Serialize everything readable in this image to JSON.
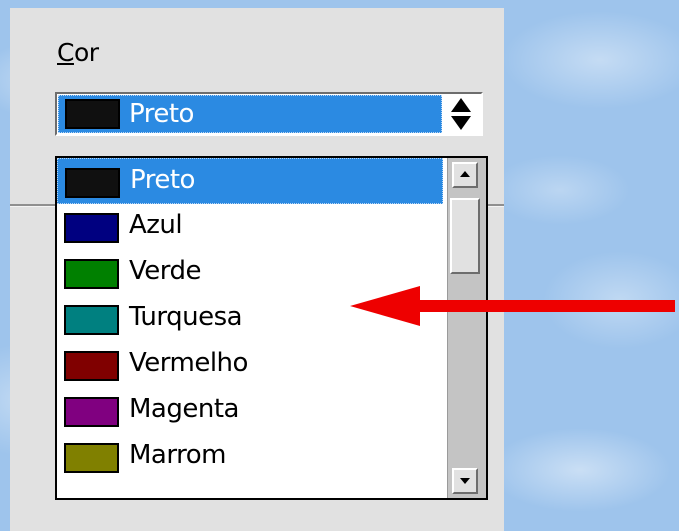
{
  "field": {
    "label_first": "C",
    "label_rest": "or"
  },
  "combo": {
    "selected_label": "Preto",
    "selected_color": "#101010"
  },
  "options": [
    {
      "label": "Preto",
      "color": "#101010",
      "selected": true
    },
    {
      "label": "Azul",
      "color": "#000080",
      "selected": false
    },
    {
      "label": "Verde",
      "color": "#008000",
      "selected": false
    },
    {
      "label": "Turquesa",
      "color": "#008080",
      "selected": false
    },
    {
      "label": "Vermelho",
      "color": "#800000",
      "selected": false
    },
    {
      "label": "Magenta",
      "color": "#800080",
      "selected": false
    },
    {
      "label": "Marrom",
      "color": "#808000",
      "selected": false
    }
  ],
  "colors": {
    "highlight": "#2b8ae2",
    "annotation_arrow": "#ee0000"
  },
  "icons": {
    "spin_up": "triangle-up",
    "spin_down": "triangle-down",
    "scroll_up": "scroll-up-arrow",
    "scroll_down": "scroll-down-arrow",
    "annotation": "red-arrow-left"
  }
}
